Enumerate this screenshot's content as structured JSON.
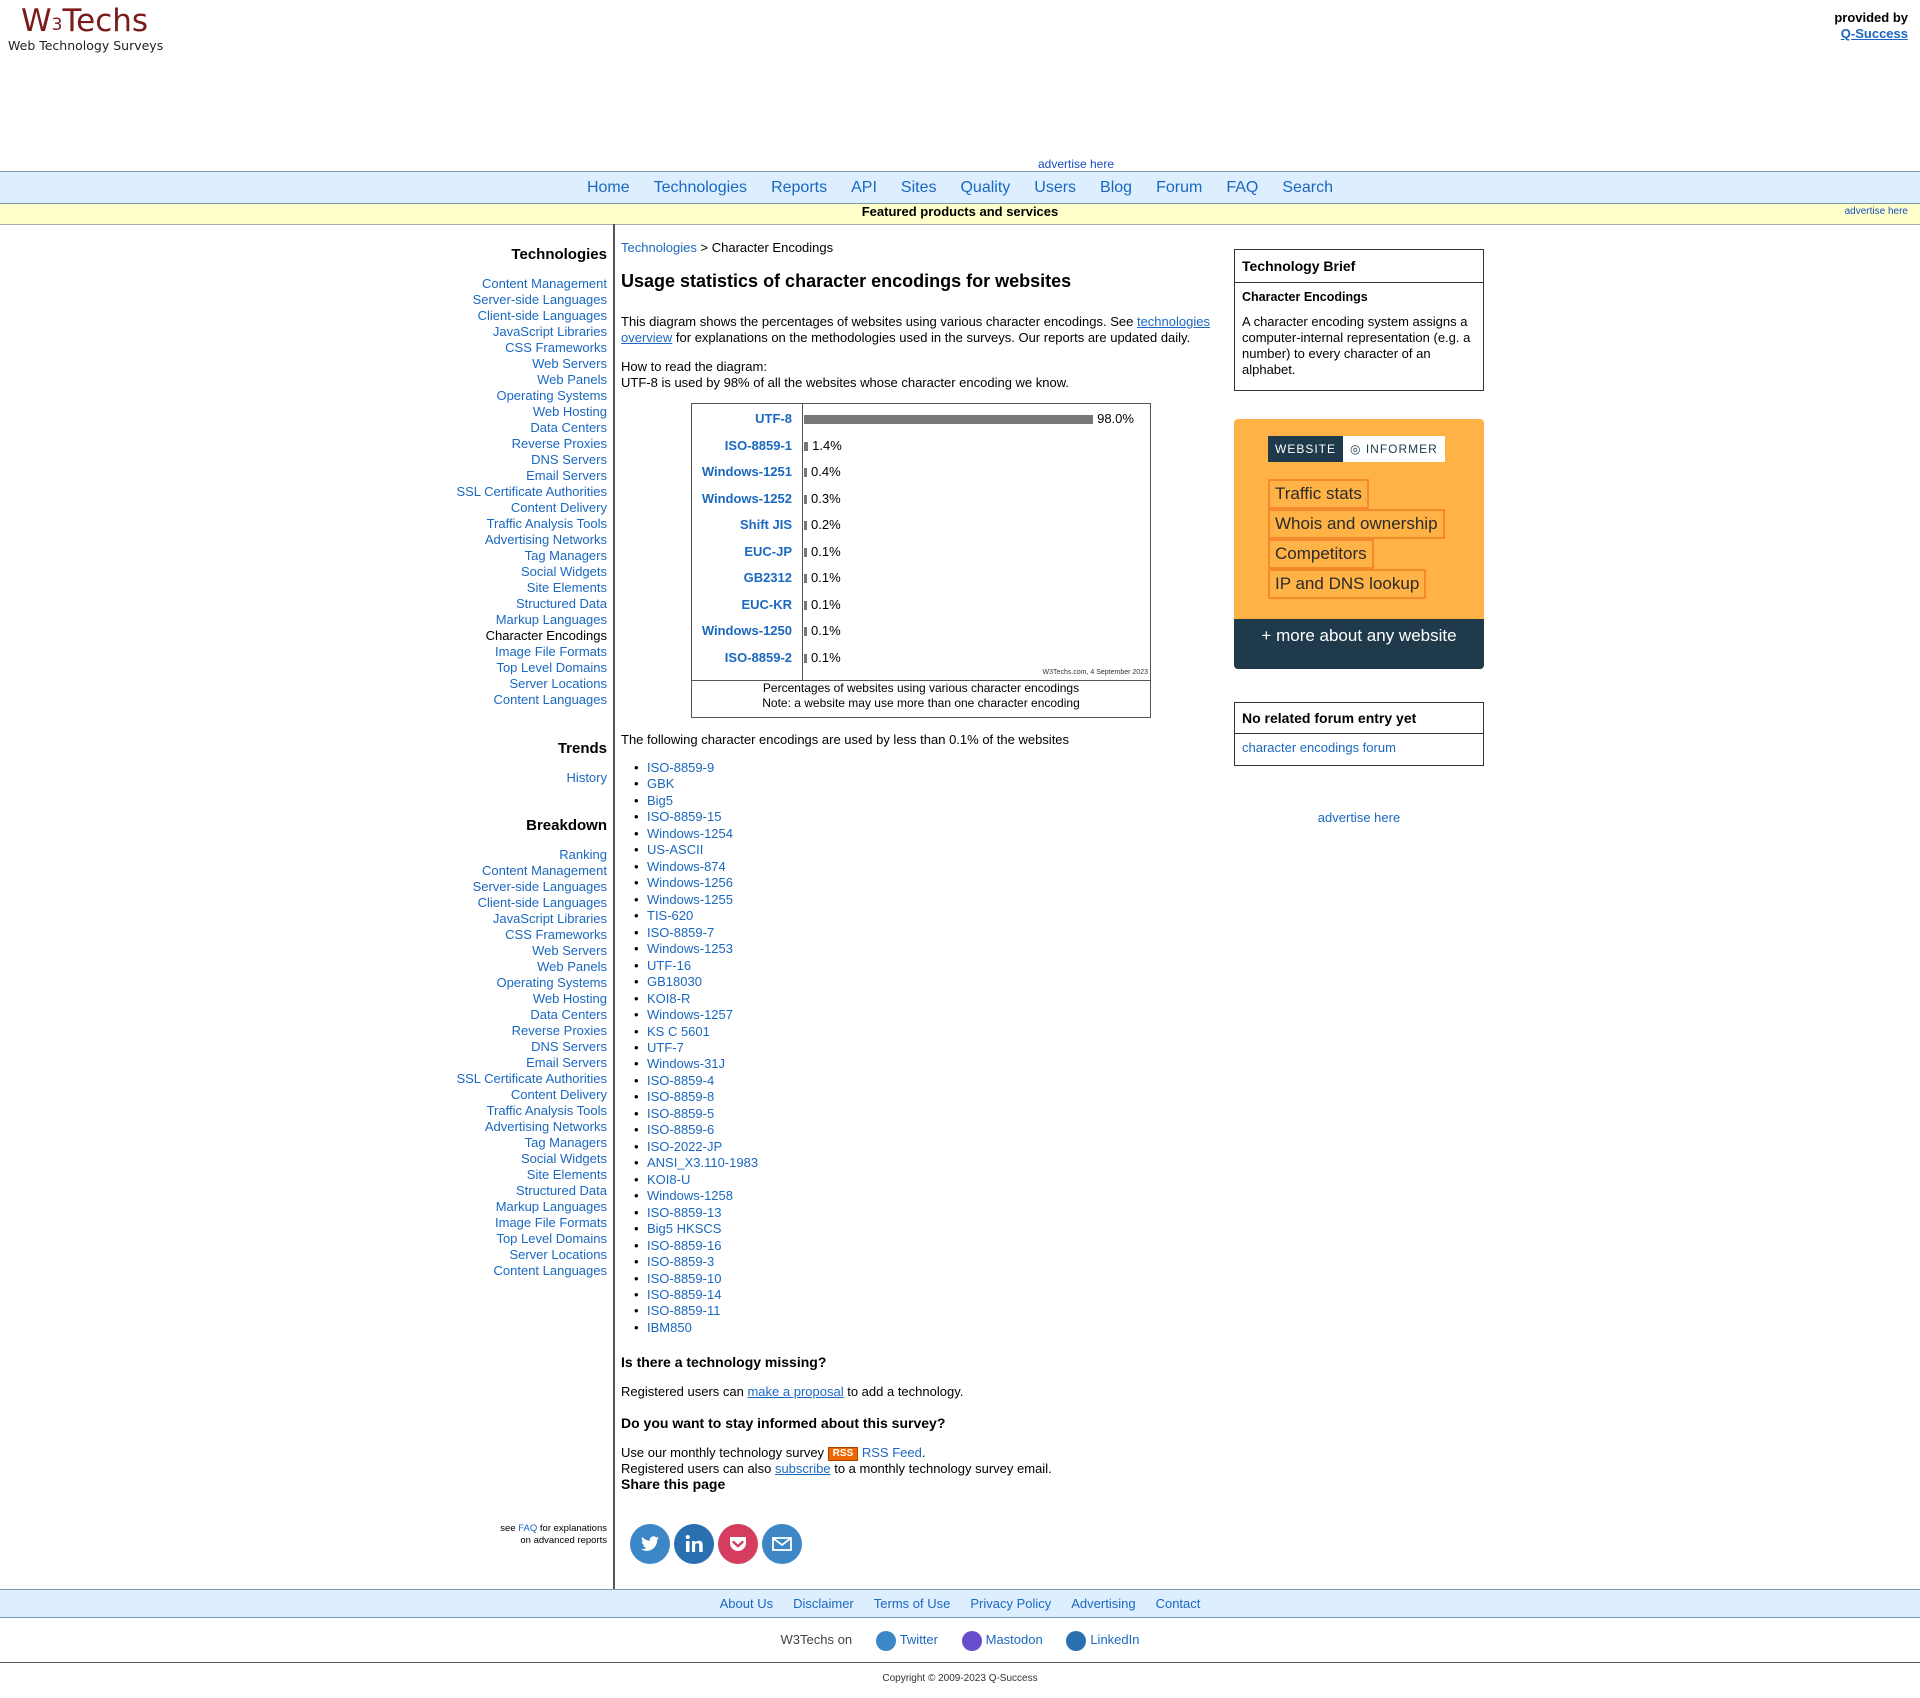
{
  "header": {
    "logo_brand": "W3Techs",
    "logo_tagline": "Web Technology Surveys",
    "provided_by": "provided by",
    "provider_link": "Q-Success",
    "advertise_top": "advertise here"
  },
  "nav": [
    "Home",
    "Technologies",
    "Reports",
    "API",
    "Sites",
    "Quality",
    "Users",
    "Blog",
    "Forum",
    "FAQ",
    "Search"
  ],
  "featured": {
    "label": "Featured products and services",
    "advertise": "advertise here"
  },
  "sidebar": {
    "technologies_title": "Technologies",
    "technologies": [
      "Content Management",
      "Server-side Languages",
      "Client-side Languages",
      "JavaScript Libraries",
      "CSS Frameworks",
      "Web Servers",
      "Web Panels",
      "Operating Systems",
      "Web Hosting",
      "Data Centers",
      "Reverse Proxies",
      "DNS Servers",
      "Email Servers",
      "SSL Certificate Authorities",
      "Content Delivery",
      "Traffic Analysis Tools",
      "Advertising Networks",
      "Tag Managers",
      "Social Widgets",
      "Site Elements",
      "Structured Data",
      "Markup Languages",
      "Character Encodings",
      "Image File Formats",
      "Top Level Domains",
      "Server Locations",
      "Content Languages"
    ],
    "current": "Character Encodings",
    "trends_title": "Trends",
    "trends": [
      "History"
    ],
    "breakdown_title": "Breakdown",
    "breakdown": [
      "Ranking",
      "Content Management",
      "Server-side Languages",
      "Client-side Languages",
      "JavaScript Libraries",
      "CSS Frameworks",
      "Web Servers",
      "Web Panels",
      "Operating Systems",
      "Web Hosting",
      "Data Centers",
      "Reverse Proxies",
      "DNS Servers",
      "Email Servers",
      "SSL Certificate Authorities",
      "Content Delivery",
      "Traffic Analysis Tools",
      "Advertising Networks",
      "Tag Managers",
      "Social Widgets",
      "Site Elements",
      "Structured Data",
      "Markup Languages",
      "Image File Formats",
      "Top Level Domains",
      "Server Locations",
      "Content Languages"
    ],
    "note_see": "see",
    "note_faq": "FAQ",
    "note_rest1": "for explanations",
    "note_rest2": "on advanced reports"
  },
  "main": {
    "breadcrumb_link": "Technologies",
    "breadcrumb_sep": ">",
    "breadcrumb_current": "Character Encodings",
    "title": "Usage statistics of character encodings for websites",
    "intro_a": "This diagram shows the percentages of websites using various character encodings. See",
    "intro_link": "technologies overview",
    "intro_b": "for explanations on the methodologies used in the surveys. Our reports are updated daily.",
    "howto_1": "How to read the diagram:",
    "howto_2": "UTF-8 is used by 98% of all the websites whose character encoding we know.",
    "chart_credit": "W3Techs.com, 4 September 2023",
    "chart_caption_1": "Percentages of websites using various character encodings",
    "chart_caption_2": "Note: a website may use more than one character encoding",
    "less_note": "The following character encodings are used by less than 0.1% of the websites",
    "less_list": [
      "ISO-8859-9",
      "GBK",
      "Big5",
      "ISO-8859-15",
      "Windows-1254",
      "US-ASCII",
      "Windows-874",
      "Windows-1256",
      "Windows-1255",
      "TIS-620",
      "ISO-8859-7",
      "Windows-1253",
      "UTF-16",
      "GB18030",
      "KOI8-R",
      "Windows-1257",
      "KS C 5601",
      "UTF-7",
      "Windows-31J",
      "ISO-8859-4",
      "ISO-8859-8",
      "ISO-8859-5",
      "ISO-8859-6",
      "ISO-2022-JP",
      "ANSI_X3.110-1983",
      "KOI8-U",
      "Windows-1258",
      "ISO-8859-13",
      "Big5 HKSCS",
      "ISO-8859-16",
      "ISO-8859-3",
      "ISO-8859-10",
      "ISO-8859-14",
      "ISO-8859-11",
      "IBM850"
    ],
    "missing_title": "Is there a technology missing?",
    "missing_a": "Registered users can",
    "missing_link": "make a proposal",
    "missing_b": "to add a technology.",
    "informed_title": "Do you want to stay informed about this survey?",
    "informed_a": "Use our monthly technology survey",
    "rss_badge": "RSS",
    "rss_link": "RSS Feed",
    "informed_b": "Registered users can also",
    "subscribe_link": "subscribe",
    "informed_c": "to a monthly technology survey email.",
    "share_title": "Share this page"
  },
  "chart_data": {
    "type": "bar",
    "orientation": "horizontal",
    "categories": [
      "UTF-8",
      "ISO-8859-1",
      "Windows-1251",
      "Windows-1252",
      "Shift JIS",
      "EUC-JP",
      "GB2312",
      "EUC-KR",
      "Windows-1250",
      "ISO-8859-2"
    ],
    "values": [
      98.0,
      1.4,
      0.4,
      0.3,
      0.2,
      0.1,
      0.1,
      0.1,
      0.1,
      0.1
    ],
    "value_labels": [
      "98.0%",
      "1.4%",
      "0.4%",
      "0.3%",
      "0.2%",
      "0.1%",
      "0.1%",
      "0.1%",
      "0.1%",
      "0.1%"
    ],
    "xlim": [
      0,
      100
    ],
    "bar_color": "#777777"
  },
  "right": {
    "brief_title": "Technology Brief",
    "brief_subtitle": "Character Encodings",
    "brief_text": "A character encoding system assigns a computer-internal representation (e.g. a number) to every character of an alphabet.",
    "informer_left": "WEBSITE",
    "informer_right": "INFORMER",
    "informer_items": [
      "Traffic stats",
      "Whois and ownership",
      "Competitors",
      "IP and DNS lookup"
    ],
    "informer_more": "+ more about any website",
    "forum_title": "No related forum entry yet",
    "forum_link": "character encodings forum",
    "advertise": "advertise here"
  },
  "footer": {
    "links": [
      "About Us",
      "Disclaimer",
      "Terms of Use",
      "Privacy Policy",
      "Advertising",
      "Contact"
    ],
    "on_label": "W3Techs on",
    "social": [
      "Twitter",
      "Mastodon",
      "LinkedIn"
    ],
    "copyright": "Copyright © 2009-2023 Q-Success"
  }
}
